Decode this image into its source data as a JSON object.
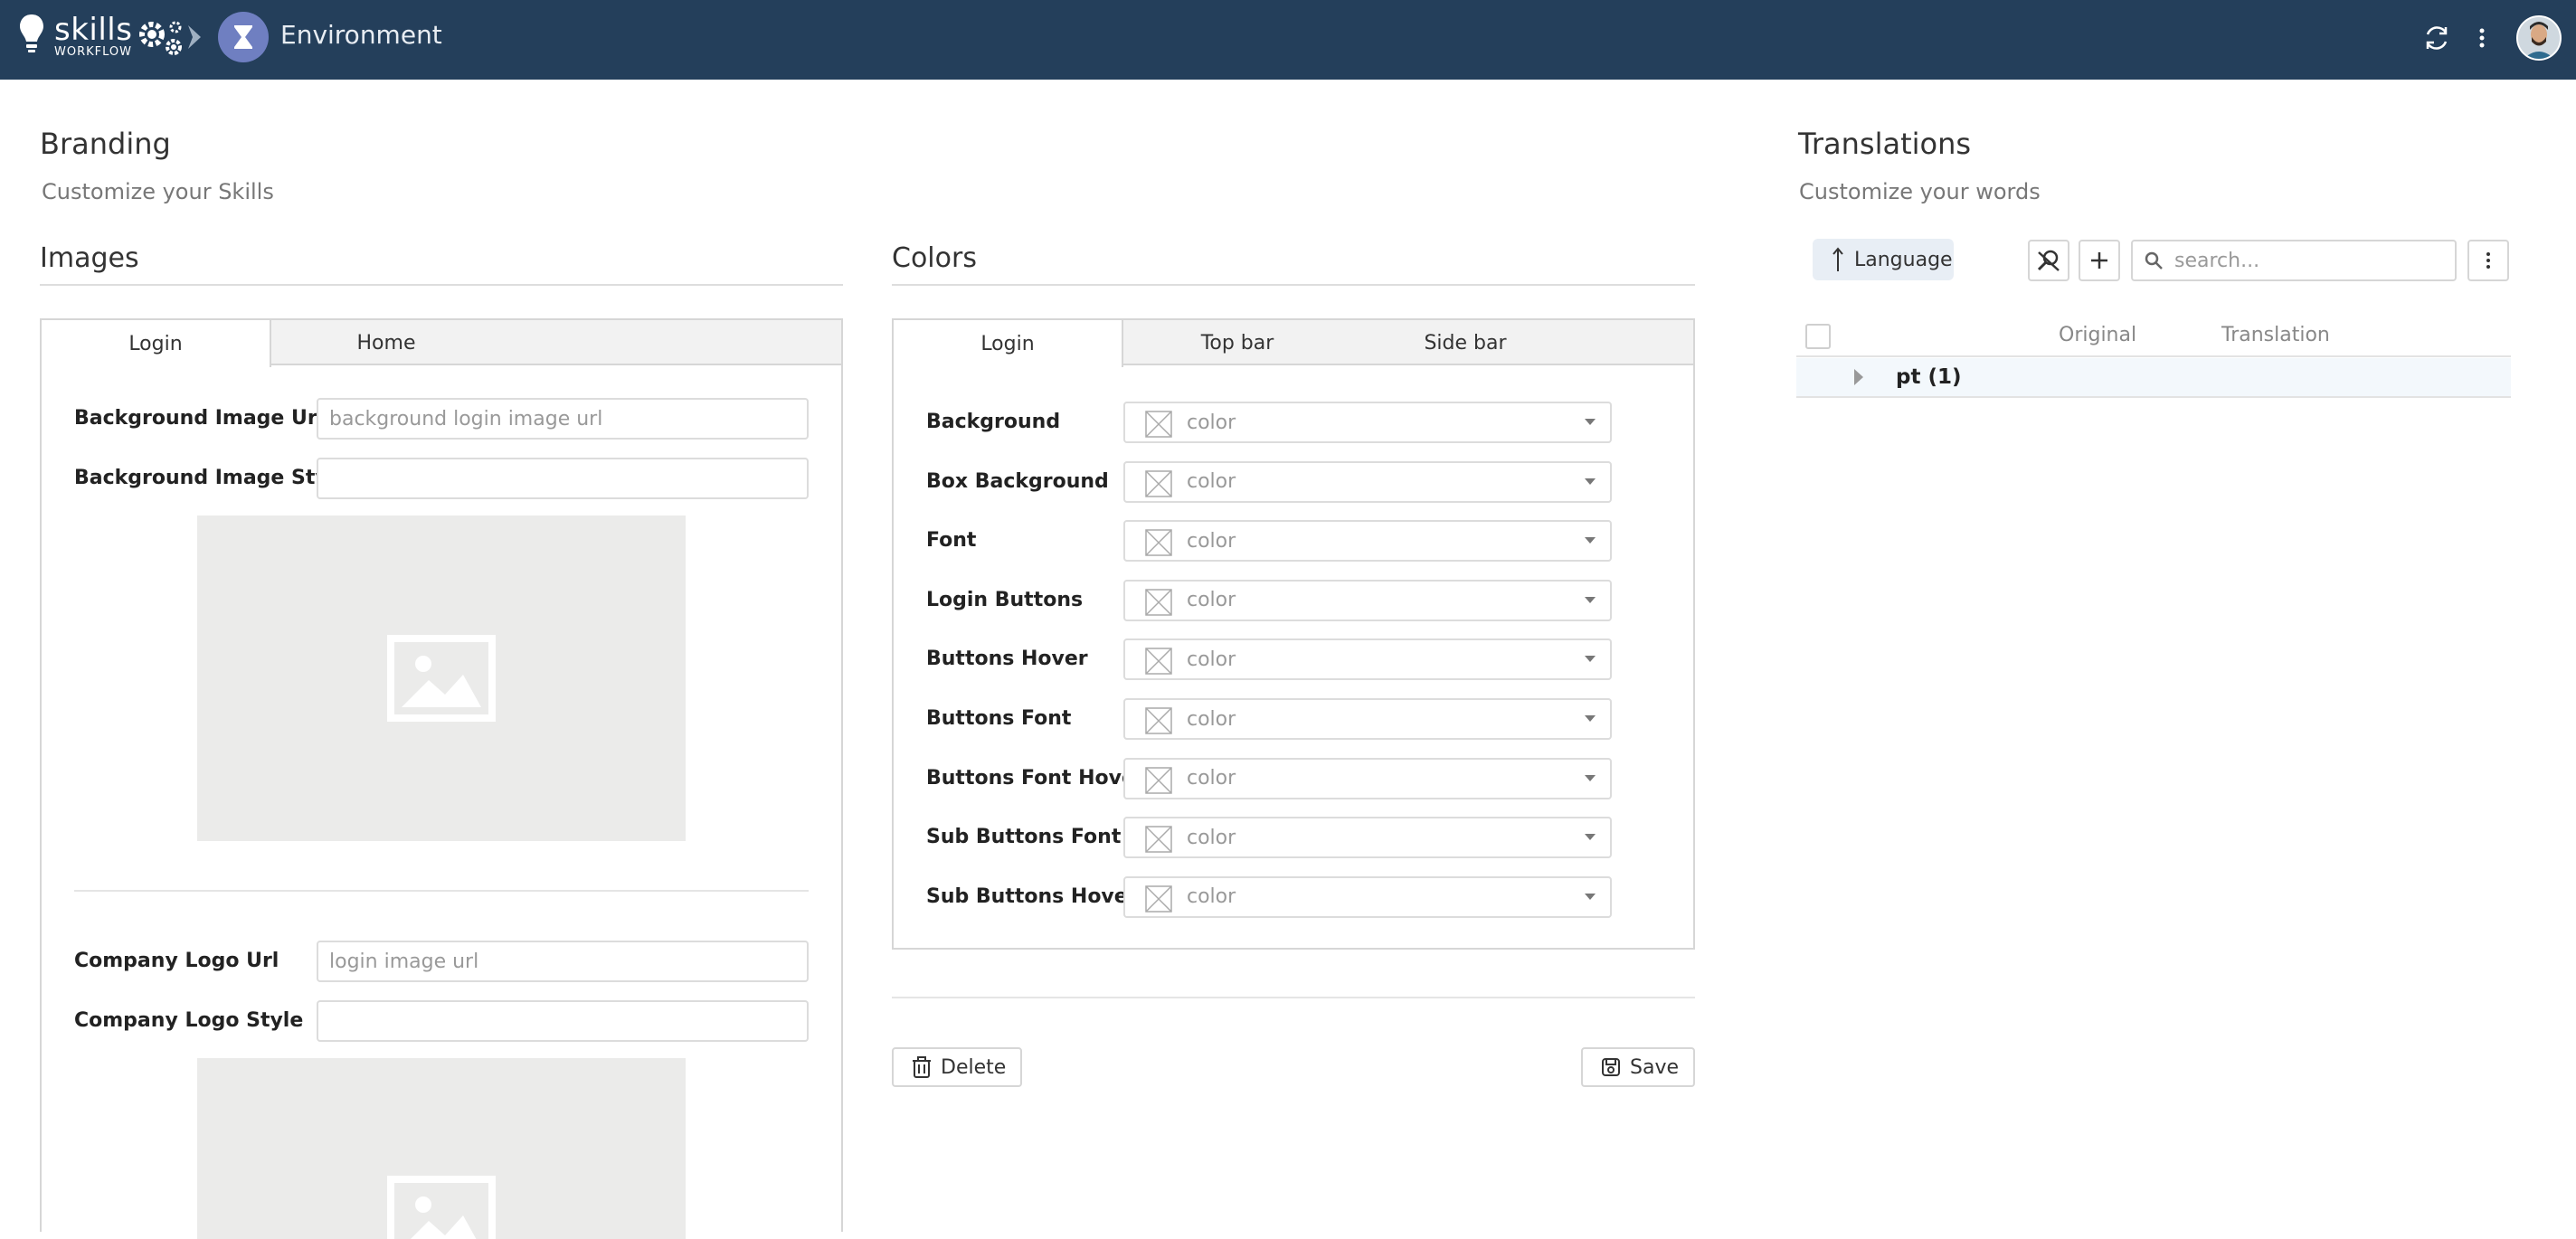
{
  "topbar": {
    "logo_word": "skills",
    "logo_sub": "WORKFLOW",
    "breadcrumb_title": "Environment"
  },
  "branding": {
    "title": "Branding",
    "subtitle": "Customize your Skills"
  },
  "images": {
    "title": "Images",
    "tabs": [
      "Login",
      "Home"
    ],
    "active_tab": "Login",
    "fields": {
      "bg_url_label": "Background Image Url",
      "bg_url_placeholder": "background login image url",
      "bg_style_label": "Background Image Style",
      "logo_url_label": "Company Logo Url",
      "logo_url_placeholder": "login image url",
      "logo_style_label": "Company Logo Style"
    }
  },
  "colors": {
    "title": "Colors",
    "tabs": [
      "Login",
      "Top bar",
      "Side bar"
    ],
    "active_tab": "Login",
    "rows": [
      {
        "label": "Background",
        "value": "color"
      },
      {
        "label": "Box Background",
        "value": "color"
      },
      {
        "label": "Font",
        "value": "color"
      },
      {
        "label": "Login Buttons",
        "value": "color"
      },
      {
        "label": "Buttons Hover",
        "value": "color"
      },
      {
        "label": "Buttons Font",
        "value": "color"
      },
      {
        "label": "Buttons Font Hover",
        "value": "color"
      },
      {
        "label": "Sub Buttons Font",
        "value": "color"
      },
      {
        "label": "Sub Buttons Hover",
        "value": "color"
      }
    ]
  },
  "actions": {
    "delete_label": "Delete",
    "save_label": "Save"
  },
  "translations": {
    "title": "Translations",
    "subtitle": "Customize your words",
    "group_by_label": "Language",
    "search_placeholder": "search...",
    "columns": {
      "original": "Original",
      "translation": "Translation"
    },
    "rows": [
      {
        "label": "pt (1)"
      }
    ]
  },
  "theme": {
    "topbar_bg": "#243f5b",
    "breadcrumb_avatar_bg": "#6f7fc1",
    "row_highlight": "#f3f8fc"
  }
}
